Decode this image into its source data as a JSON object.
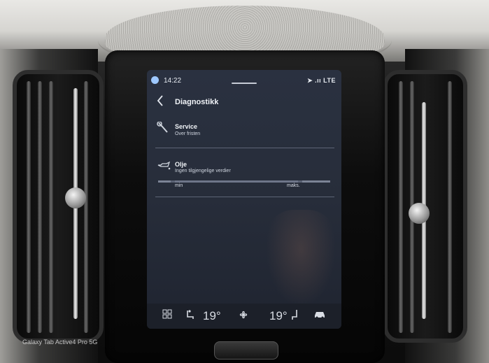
{
  "status_bar": {
    "time": "14:22",
    "indicators": "➤ .ıı LTE"
  },
  "header": {
    "back_icon": "chevron-left-icon",
    "title": "Diagnostikk"
  },
  "items": [
    {
      "icon": "wrench-icon",
      "title": "Service",
      "subtitle": "Over fristen"
    },
    {
      "icon": "oil-can-icon",
      "title": "Olje",
      "subtitle": "Ingen tilgjengelige verdier"
    }
  ],
  "oil_gauge": {
    "min_label": "min",
    "max_label": "maks."
  },
  "climate_bar": {
    "home_icon": "grid-icon",
    "left_seat_icon": "heated-seat-icon",
    "left_temp": "19°",
    "fan_icon": "fan-icon",
    "right_temp": "19°",
    "right_seat_icon": "seat-icon",
    "car_icon": "car-icon"
  },
  "watermark": "Galaxy Tab Active4 Pro 5G"
}
